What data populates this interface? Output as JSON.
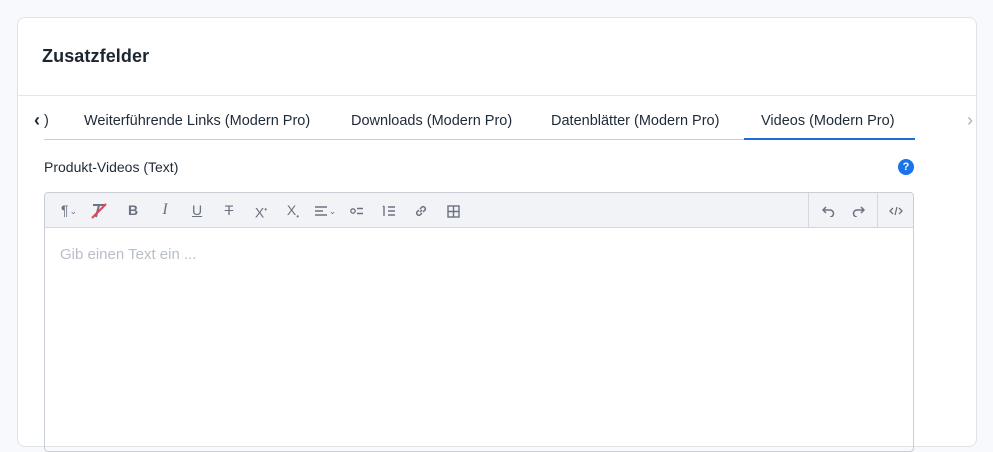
{
  "card": {
    "title": "Zusatzfelder"
  },
  "tabs": {
    "items": [
      {
        "label": ")"
      },
      {
        "label": "Weiterführende Links (Modern Pro)"
      },
      {
        "label": "Downloads (Modern Pro)"
      },
      {
        "label": "Datenblätter (Modern Pro)"
      },
      {
        "label": "Videos (Modern Pro)",
        "active": true
      }
    ],
    "prev_glyph": "‹",
    "next_glyph": "›"
  },
  "field": {
    "label": "Produkt-Videos (Text)",
    "help_glyph": "?"
  },
  "toolbar": {
    "paragraph": "¶",
    "bold": "B",
    "italic": "I",
    "underline": "U",
    "strikethrough": "T",
    "superscript": "X",
    "subscript": "X",
    "caret": "⌄"
  },
  "editor": {
    "placeholder": "Gib einen Text ein ..."
  },
  "colors": {
    "accent": "#1c6ed4",
    "help": "#1a73e8",
    "border": "#c9ced6"
  }
}
